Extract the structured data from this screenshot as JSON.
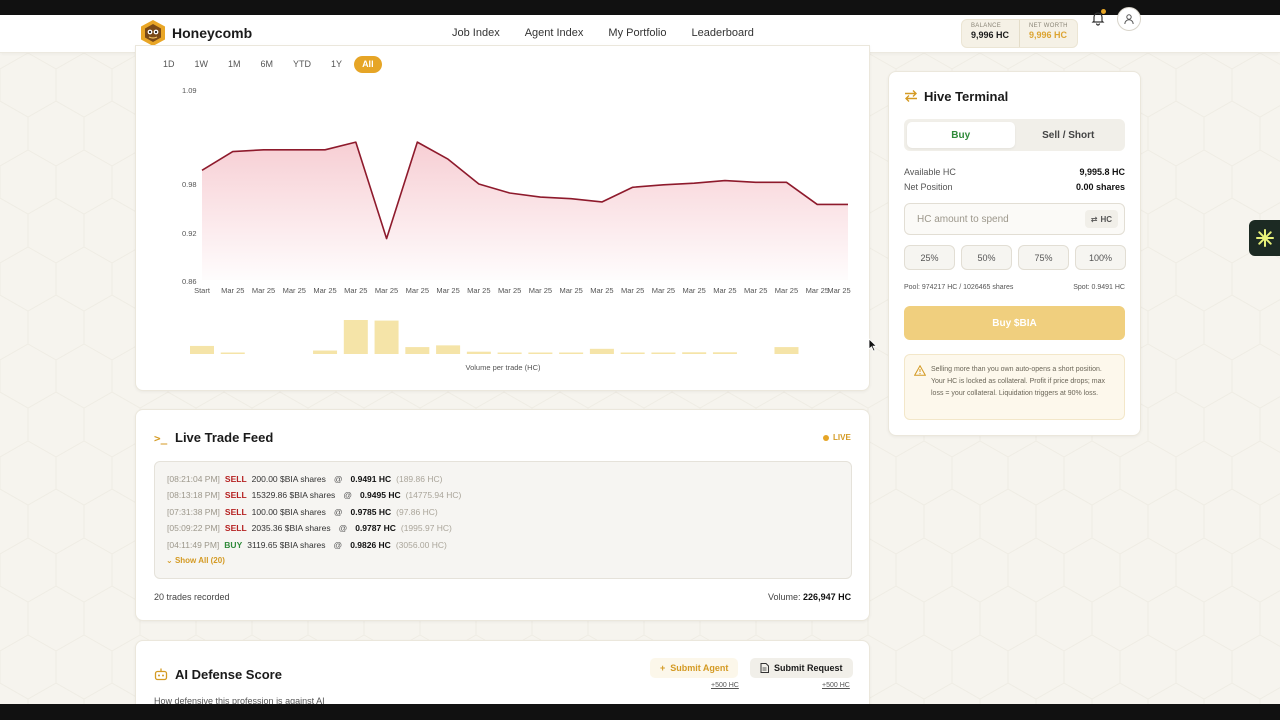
{
  "app": {
    "name": "Honeycomb"
  },
  "nav": {
    "links": [
      "Job Index",
      "Agent Index",
      "My Portfolio",
      "Leaderboard"
    ]
  },
  "wallet": {
    "balance_label": "BALANCE",
    "balance_value": "9,996 HC",
    "networth_label": "NET WORTH",
    "networth_value": "9,996 HC"
  },
  "range_tabs": [
    "1D",
    "1W",
    "1M",
    "6M",
    "YTD",
    "1Y",
    "All"
  ],
  "range_selected": "All",
  "chart_data": {
    "type": "area",
    "x": [
      "Start",
      "Mar 25",
      "Mar 25",
      "Mar 25",
      "Mar 25",
      "Mar 25",
      "Mar 25",
      "Mar 25",
      "Mar 25",
      "Mar 25",
      "Mar 25",
      "Mar 25",
      "Mar 25",
      "Mar 25",
      "Mar 25",
      "Mar 25",
      "Mar 25",
      "Mar 25",
      "Mar 25",
      "Mar 25",
      "Mar 25",
      "Mar 25"
    ],
    "series": [
      {
        "values": [
          0.996,
          1.018,
          1.02,
          1.02,
          1.02,
          1.029,
          0.913,
          1.029,
          1.009,
          0.98,
          0.969,
          0.964,
          0.962,
          0.958,
          0.976,
          0.979,
          0.981,
          0.984,
          0.982,
          0.982,
          0.955,
          0.955
        ]
      }
    ],
    "volume": [
      28,
      2,
      0,
      0,
      12,
      118,
      116,
      24,
      30,
      8,
      4,
      2,
      4,
      18,
      4,
      4,
      6,
      6,
      0,
      24,
      0,
      0
    ],
    "yticks": [
      "1.09",
      "0.98",
      "0.92",
      "0.86"
    ],
    "ylim": [
      0.86,
      1.09
    ],
    "volume_label": "Volume per trade (HC)",
    "colors": {
      "line": "#8e1a2c",
      "fill": "#f6c9cf",
      "volume": "#f5e4a8"
    }
  },
  "feed": {
    "title": "Live Trade Feed",
    "live_label": "LIVE",
    "rows": [
      {
        "time": "[08:21:04 PM]",
        "side": "SELL",
        "amount": "200.00 $BIA shares",
        "at": "@",
        "price": "0.9491 HC",
        "total": "(189.86 HC)"
      },
      {
        "time": "[08:13:18 PM]",
        "side": "SELL",
        "amount": "15329.86 $BIA shares",
        "at": "@",
        "price": "0.9495 HC",
        "total": "(14775.94 HC)"
      },
      {
        "time": "[07:31:38 PM]",
        "side": "SELL",
        "amount": "100.00 $BIA shares",
        "at": "@",
        "price": "0.9785 HC",
        "total": "(97.86 HC)"
      },
      {
        "time": "[05:09:22 PM]",
        "side": "SELL",
        "amount": "2035.36 $BIA shares",
        "at": "@",
        "price": "0.9787 HC",
        "total": "(1995.97 HC)"
      },
      {
        "time": "[04:11:49 PM]",
        "side": "BUY",
        "amount": "3119.65 $BIA shares",
        "at": "@",
        "price": "0.9826 HC",
        "total": "(3056.00 HC)"
      }
    ],
    "show_all": "Show All (20)",
    "trades_recorded": "20 trades recorded",
    "volume_label": "Volume:",
    "volume_value": "226,947 HC"
  },
  "defense": {
    "title": "AI Defense Score",
    "subtitle": "How defensive this profession is against AI",
    "submit_agent": "Submit Agent",
    "submit_request": "Submit Request",
    "agent_reward": "+500 HC",
    "request_reward": "+500 HC"
  },
  "terminal": {
    "title": "Hive Terminal",
    "tabs": [
      "Buy",
      "Sell / Short"
    ],
    "active_tab": "Buy",
    "available_label": "Available HC",
    "available_value": "9,995.8 HC",
    "position_label": "Net Position",
    "position_value": "0.00 shares",
    "amount_placeholder": "HC amount to spend",
    "unit_toggle": "HC",
    "percent_buttons": [
      "25%",
      "50%",
      "75%",
      "100%"
    ],
    "pool": "Pool: 974217 HC / 1026465 shares",
    "spot": "Spot: 0.9491 HC",
    "buy_button": "Buy $BIA",
    "warning": "Selling more than you own auto-opens a short position. Your HC is locked as collateral. Profit if price drops; max loss = your collateral. Liquidation triggers at 90% loss."
  }
}
